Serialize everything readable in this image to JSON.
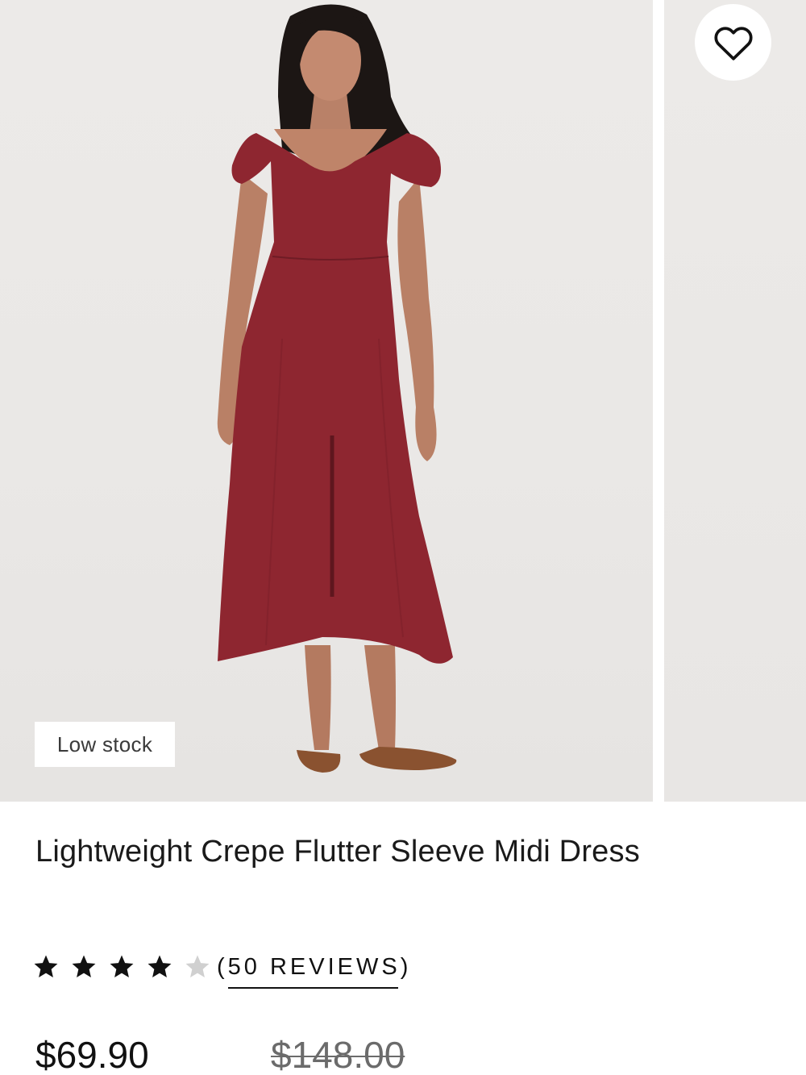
{
  "product": {
    "badge": "Low stock",
    "title": "Lightweight Crepe Flutter Sleeve Midi Dress",
    "rating": 4,
    "rating_max": 5,
    "reviews_label": "(50 REVIEWS)",
    "sale_price": "$69.90",
    "original_price": "$148.00",
    "dress_color": "#8e2630"
  },
  "icons": {
    "wishlist": "heart-outline-icon",
    "star_filled": "star-filled-icon",
    "star_empty": "star-empty-icon"
  },
  "colors": {
    "text": "#111111",
    "muted_price": "#6b6b6b",
    "star_filled": "#111111",
    "star_empty": "#d0d0d0",
    "image_bg": "#eae8e6"
  }
}
